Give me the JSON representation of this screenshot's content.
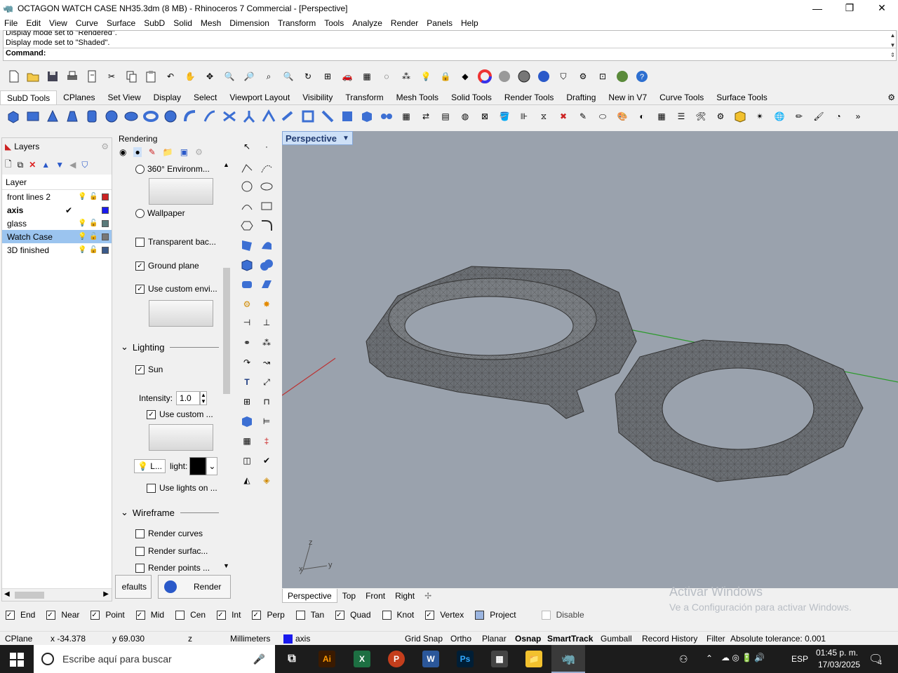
{
  "window": {
    "title": "OCTAGON WATCH CASE NH35.3dm (8 MB) - Rhinoceros 7 Commercial - [Perspective]"
  },
  "menu": [
    "File",
    "Edit",
    "View",
    "Curve",
    "Surface",
    "SubD",
    "Solid",
    "Mesh",
    "Dimension",
    "Transform",
    "Tools",
    "Analyze",
    "Render",
    "Panels",
    "Help"
  ],
  "command": {
    "history1": "Display mode set to \"Rendered\".",
    "history2": "Display mode set to \"Shaded\".",
    "prompt": "Command:"
  },
  "toolbar_tabs": [
    "SubD Tools",
    "CPlanes",
    "Set View",
    "Display",
    "Select",
    "Viewport Layout",
    "Visibility",
    "Transform",
    "Mesh Tools",
    "Solid Tools",
    "Render Tools",
    "Drafting",
    "New in V7",
    "Curve Tools",
    "Surface Tools"
  ],
  "layers": {
    "title": "Layers",
    "column": "Layer",
    "rows": [
      {
        "name": "front lines 2",
        "color": "#cc2222"
      },
      {
        "name": "axis",
        "color": "#1a1aee",
        "current": true
      },
      {
        "name": "glass",
        "color": "#5a7a7a"
      },
      {
        "name": "Watch Case",
        "color": "#777777",
        "selected": true
      },
      {
        "name": "3D finished",
        "color": "#3a5a8a"
      }
    ]
  },
  "render_panel": {
    "title": "Rendering",
    "env360": "360° Environm...",
    "wallpaper": "Wallpaper",
    "transparent": "Transparent bac...",
    "ground_plane": "Ground plane",
    "use_custom_env": "Use custom envi...",
    "lighting": "Lighting",
    "sun": "Sun",
    "intensity_label": "Intensity:",
    "intensity_value": "1.0",
    "use_custom": "Use custom ...",
    "light_btn": "L...",
    "light_label": "light:",
    "use_lights_on": "Use lights on ...",
    "wireframe": "Wireframe",
    "render_curves": "Render curves",
    "render_surfaces": "Render surfac...",
    "render_points": "Render points ...",
    "defaults_btn": "efaults",
    "render_btn": "Render"
  },
  "viewport": {
    "title": "Perspective",
    "tabs": [
      "Perspective",
      "Top",
      "Front",
      "Right"
    ],
    "axis_z": "z",
    "axis_y": "y",
    "axis_x": "x"
  },
  "osnap": [
    {
      "label": "End",
      "checked": true
    },
    {
      "label": "Near",
      "checked": true
    },
    {
      "label": "Point",
      "checked": true
    },
    {
      "label": "Mid",
      "checked": true
    },
    {
      "label": "Cen",
      "checked": false
    },
    {
      "label": "Int",
      "checked": true
    },
    {
      "label": "Perp",
      "checked": true
    },
    {
      "label": "Tan",
      "checked": false
    },
    {
      "label": "Quad",
      "checked": true
    },
    {
      "label": "Knot",
      "checked": false
    },
    {
      "label": "Vertex",
      "checked": true
    },
    {
      "label": "Project",
      "checked": false
    },
    {
      "label": "Disable",
      "checked": false
    }
  ],
  "status": {
    "cplane": "CPlane",
    "x": "x -34.378",
    "y": "y 69.030",
    "z": "z",
    "units": "Millimeters",
    "layer": "axis",
    "grid_snap": "Grid Snap",
    "ortho": "Ortho",
    "planar": "Planar",
    "osnap": "Osnap",
    "smarttrack": "SmartTrack",
    "gumball": "Gumball",
    "record_history": "Record History",
    "filter": "Filter",
    "tolerance": "Absolute tolerance: 0.001"
  },
  "watermark": {
    "line1": "Activar Windows",
    "line2": "Ve a Configuración para activar Windows."
  },
  "taskbar": {
    "search_placeholder": "Escribe aquí para buscar",
    "lang": "ESP",
    "time": "01:45 p. m.",
    "date": "17/03/2025",
    "notif_count": "4"
  }
}
